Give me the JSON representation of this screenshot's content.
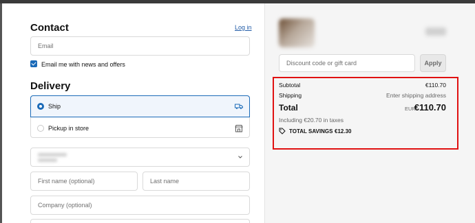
{
  "contact": {
    "title": "Contact",
    "login_link": "Log in",
    "email_placeholder": "Email",
    "newsletter_label": "Email me with news and offers",
    "newsletter_checked": true
  },
  "delivery": {
    "title": "Delivery",
    "options": [
      {
        "label": "Ship",
        "selected": true,
        "icon": "truck-icon"
      },
      {
        "label": "Pickup in store",
        "selected": false,
        "icon": "store-icon"
      }
    ],
    "first_name_placeholder": "First name (optional)",
    "last_name_placeholder": "Last name",
    "company_placeholder": "Company (optional)"
  },
  "summary": {
    "discount_placeholder": "Discount code or gift card",
    "apply_label": "Apply",
    "subtotal_label": "Subtotal",
    "subtotal_value": "€110.70",
    "shipping_label": "Shipping",
    "shipping_value": "Enter shipping address",
    "total_label": "Total",
    "total_currency": "EUR",
    "total_value": "€110.70",
    "taxes_text": "Including €20.70 in taxes",
    "savings_label": "TOTAL SAVINGS",
    "savings_value": "€12.30"
  },
  "colors": {
    "accent": "#1a6ab8",
    "highlight_box": "#e01010",
    "summary_bg": "#f5f5f5"
  }
}
